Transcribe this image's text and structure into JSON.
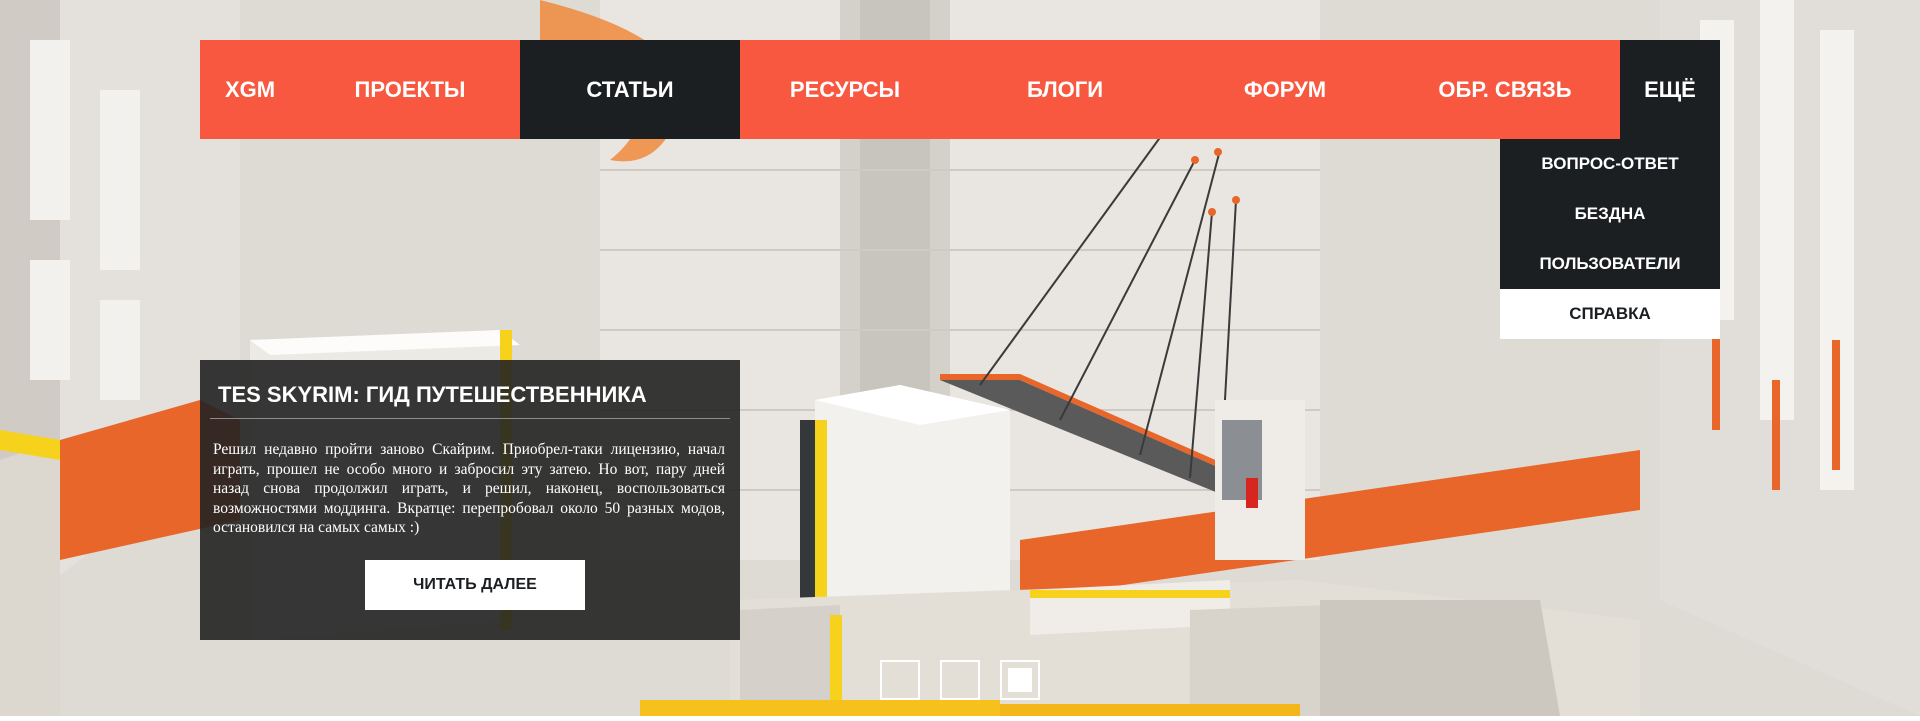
{
  "colors": {
    "accent": "#f7583f",
    "dark": "#1c1f21",
    "card_background": "#222222",
    "light": "#ffffff"
  },
  "nav": {
    "logo": "XGM",
    "items": [
      {
        "label": "ПРОЕКТЫ",
        "active": false
      },
      {
        "label": "СТАТЬИ",
        "active": true
      },
      {
        "label": "РЕСУРСЫ",
        "active": false
      },
      {
        "label": "БЛОГИ",
        "active": false
      },
      {
        "label": "ФОРУМ",
        "active": false
      },
      {
        "label": "ОБР. СВЯЗЬ",
        "active": false
      }
    ],
    "more": "ЕЩЁ"
  },
  "dropdown": {
    "items": [
      {
        "label": "ВОПРОС-ОТВЕТ",
        "highlighted": false
      },
      {
        "label": "БЕЗДНА",
        "highlighted": false
      },
      {
        "label": "ПОЛЬЗОВАТЕЛИ",
        "highlighted": false
      },
      {
        "label": "СПРАВКА",
        "highlighted": true
      }
    ]
  },
  "article": {
    "title": "TES SKYRIM: ГИД ПУТЕШЕСТВЕННИКА",
    "excerpt": "Решил недавно пройти заново Скайрим. Приобрел-таки лицензию, начал играть, прошел не особо много и забросил эту затею. Но вот, пару дней назад снова продолжил играть, и решил, наконец, воспользоваться возможностями моддинга. Вкратце: перепробовал около 50 разных модов, остановился на самых самых :)",
    "read_more": "ЧИТАТЬ ДАЛЕЕ"
  },
  "slider": {
    "slide_count": 3,
    "active_slide": 3
  }
}
